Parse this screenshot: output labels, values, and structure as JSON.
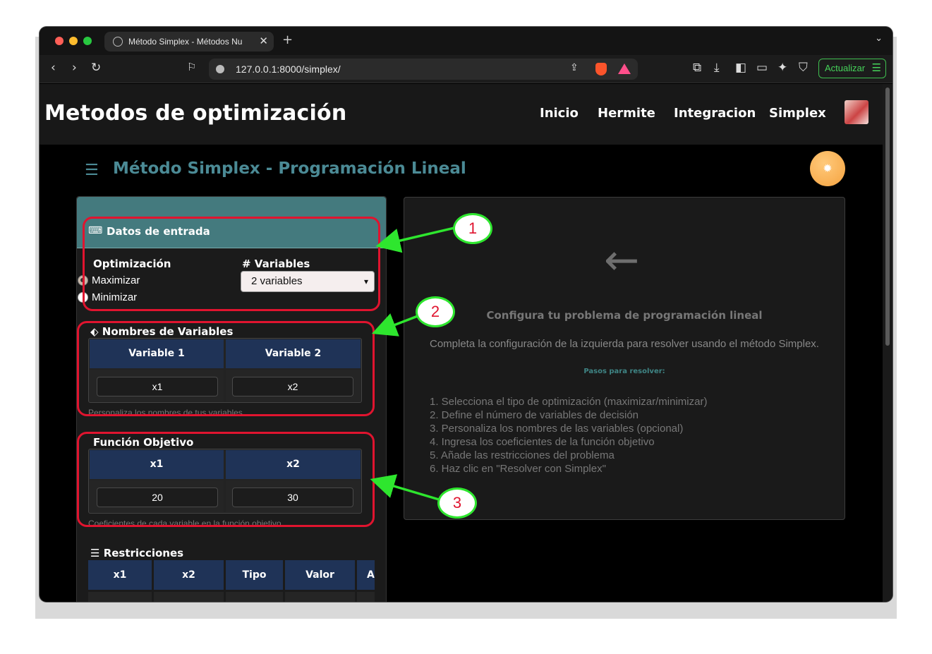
{
  "browser": {
    "tab_title": "Método Simplex - Métodos Nu",
    "url": "127.0.0.1:8000/simplex/",
    "update_label": "Actualizar"
  },
  "site": {
    "brand": "Metodos de optimización",
    "nav": [
      "Inicio",
      "Hermite",
      "Integracion",
      "Simplex"
    ]
  },
  "page": {
    "title": "Método Simplex - Programación Lineal"
  },
  "form": {
    "section_title": "Datos de entrada",
    "optimization_label": "Optimización",
    "optimization_options": [
      "Maximizar",
      "Minimizar"
    ],
    "optimization_selected": "Maximizar",
    "variables_label": "# Variables",
    "variables_selected": "2 variables",
    "names_title": "Nombres de Variables",
    "names_headers": [
      "Variable 1",
      "Variable 2"
    ],
    "names_values": [
      "x1",
      "x2"
    ],
    "names_hint": "Personaliza los nombres de tus variables",
    "objective_title": "Función Objetivo",
    "objective_headers": [
      "x1",
      "x2"
    ],
    "objective_values": [
      "20",
      "30"
    ],
    "objective_hint": "Coeficientes de cada variable en la función objetivo",
    "constraints_title": "Restricciones",
    "constraints_headers": [
      "x1",
      "x2",
      "Tipo",
      "Valor",
      "A"
    ]
  },
  "result_panel": {
    "title": "Configura tu problema de programación lineal",
    "subtitle": "Completa la configuración de la izquierda para resolver usando el método Simplex.",
    "steps_title": "Pasos para resolver:",
    "steps": [
      "1. Selecciona el tipo de optimización (maximizar/minimizar)",
      "2. Define el número de variables de decisión",
      "3. Personaliza los nombres de las variables (opcional)",
      "4. Ingresa los coeficientes de la función objetivo",
      "5. Añade las restricciones del problema",
      "6. Haz clic en \"Resolver con Simplex\""
    ]
  },
  "annotations": [
    "1",
    "2",
    "3"
  ],
  "colors": {
    "annotation_box": "#e0142f",
    "annotation_circle": "#2ee62e",
    "accent": "#447a7e",
    "table_header": "#1f3357"
  }
}
